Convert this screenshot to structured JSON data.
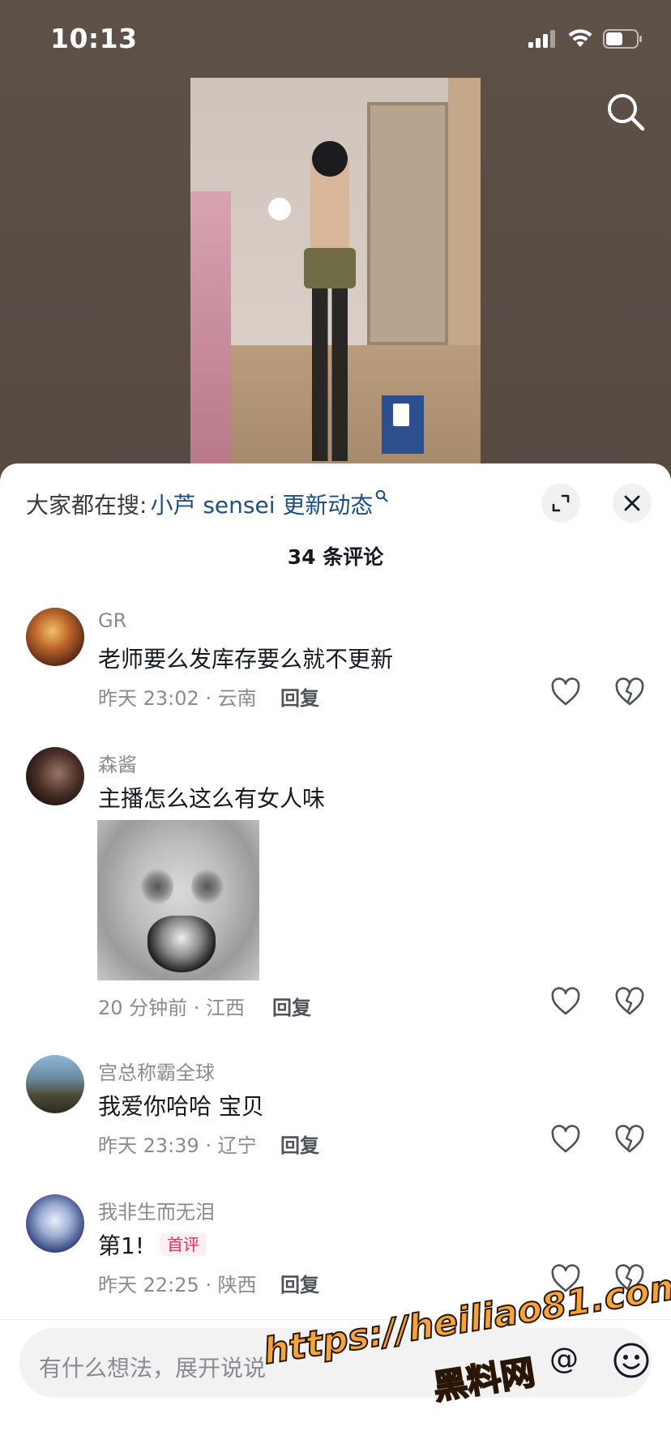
{
  "status_bar": {
    "time": "10:13"
  },
  "hot_search": {
    "label": "大家都在搜:",
    "term": "小芦 sensei 更新动态"
  },
  "comment_count": "34 条评论",
  "comments": [
    {
      "user": "GR",
      "text": "老师要么发库存要么就不更新",
      "meta": "昨天 23:02 · 云南",
      "reply": "回复",
      "avatar_colors": [
        "#e0a15a",
        "#5b2a14"
      ]
    },
    {
      "user": "森酱",
      "text": "主播怎么这么有女人味",
      "meta": "20 分钟前 · 江西",
      "reply": "回复",
      "has_sticker": true,
      "avatar_colors": [
        "#7a5a50",
        "#1c1412"
      ]
    },
    {
      "user": "宫总称霸全球",
      "text": "我爱你哈哈  宝贝",
      "meta": "昨天 23:39 · 辽宁",
      "reply": "回复",
      "avatar_colors": [
        "#7fa6c4",
        "#3a3d2a"
      ]
    },
    {
      "user": "我非生而无泪",
      "text": "第1!",
      "badge": "首评",
      "meta": "昨天 22:25 · 陕西",
      "reply": "回复",
      "avatar_colors": [
        "#a7b9d8",
        "#2a3566"
      ]
    }
  ],
  "input": {
    "placeholder": "有什么想法，展开说说"
  },
  "watermark": {
    "url": "https://heiliao81.com",
    "name": "黑料网"
  },
  "colors": {
    "accent_link": "#1f4f82",
    "badge_red": "#ee2a55",
    "muted": "#8a8b91"
  }
}
